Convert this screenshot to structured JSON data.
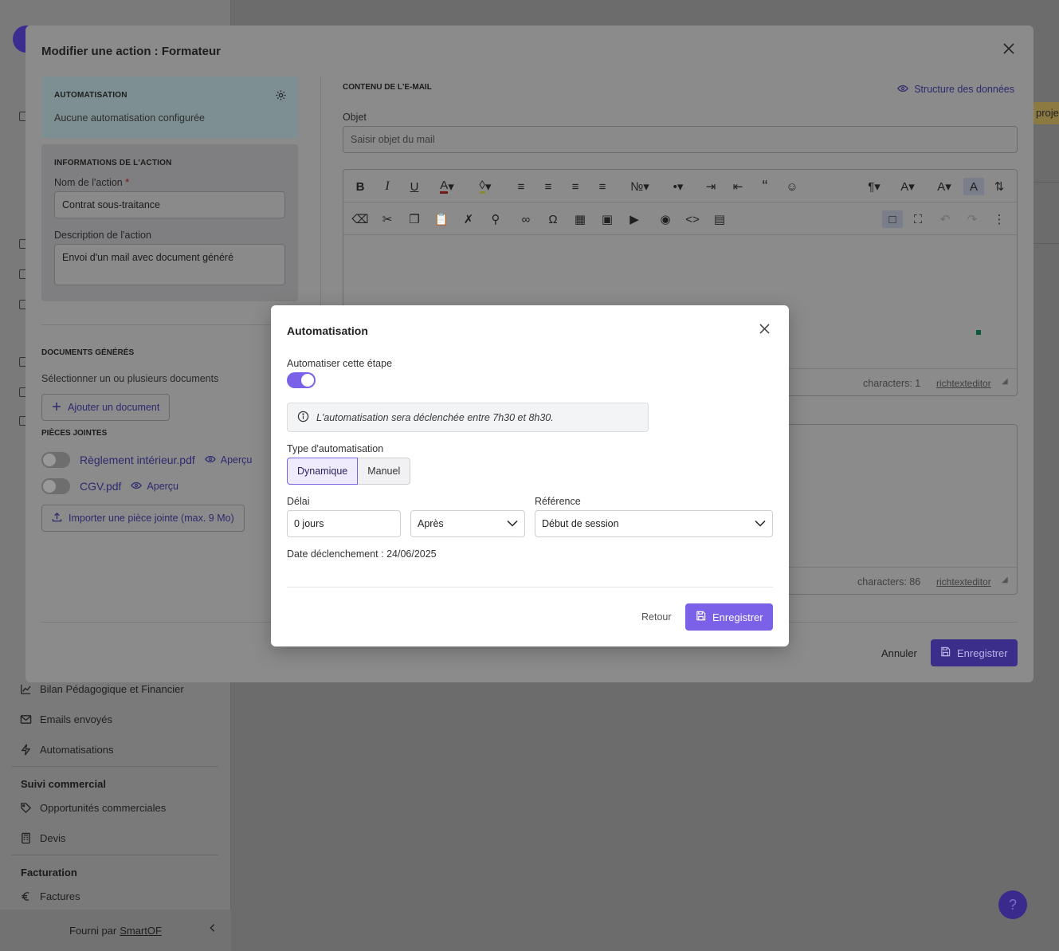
{
  "sidebar": {
    "items_bottom": [
      {
        "label": "Bilan Pédagogique et Financier",
        "icon": "chart-icon"
      },
      {
        "label": "Emails envoyés",
        "icon": "mail-icon"
      },
      {
        "label": "Automatisations",
        "icon": "bolt-icon"
      }
    ],
    "commercial_heading": "Suivi commercial",
    "commercial_items": [
      {
        "label": "Opportunités commerciales",
        "icon": "tag-icon"
      },
      {
        "label": "Devis",
        "icon": "calculator-icon"
      }
    ],
    "billing_heading": "Facturation",
    "billing_items": [
      {
        "label": "Factures",
        "icon": "euro-icon"
      }
    ],
    "footer_prefix": "Fourni par",
    "footer_brand": "SmartOF"
  },
  "background": {
    "tag_text": "projet"
  },
  "main_modal": {
    "title": "Modifier une action : Formateur",
    "automation_panel": {
      "heading": "AUTOMATISATION",
      "status": "Aucune automatisation configurée"
    },
    "info_panel": {
      "heading": "INFORMATIONS DE L'ACTION",
      "name_label": "Nom de l'action",
      "name_required": "*",
      "name_value": "Contrat sous-traitance",
      "desc_label": "Description de l'action",
      "desc_value": "Envoi d'un mail avec document généré"
    },
    "documents": {
      "heading": "DOCUMENTS GÉNÉRÉS",
      "hint": "Sélectionner un ou plusieurs documents",
      "add_button": "Ajouter un document"
    },
    "attachments": {
      "heading": "PIÈCES JOINTES",
      "items": [
        {
          "name": "Règlement intérieur.pdf",
          "preview": "Aperçu"
        },
        {
          "name": "CGV.pdf",
          "preview": "Aperçu"
        }
      ],
      "import_button": "Importer une pièce jointe (max. 9 Mo)"
    },
    "email": {
      "heading": "CONTENU DE L'E-MAIL",
      "structure_link": "Structure des données",
      "subject_label": "Objet",
      "subject_placeholder": "Saisir objet du mail",
      "editor_chars": "characters: 1",
      "editor_brand": "richtexteditor",
      "editor2_chars": "characters: 86",
      "editor2_brand": "richtexteditor"
    },
    "cancel_label": "Annuler",
    "save_label": "Enregistrer"
  },
  "dialog": {
    "title": "Automatisation",
    "toggle_label": "Automatiser cette étape",
    "toggle_on": true,
    "info_text": "L'automatisation sera déclenchée entre 7h30 et 8h30.",
    "type_label": "Type d'automatisation",
    "type_options": [
      "Dynamique",
      "Manuel"
    ],
    "type_selected": "Dynamique",
    "delay_label": "Délai",
    "delay_value": "0 jours",
    "direction_value": "Après",
    "reference_label": "Référence",
    "reference_value": "Début de session",
    "trigger_date": "Date déclenchement : 24/06/2025",
    "back_label": "Retour",
    "save_label": "Enregistrer"
  },
  "colors": {
    "accent": "#7b61e8",
    "accent_dark": "#3b2e8a"
  }
}
